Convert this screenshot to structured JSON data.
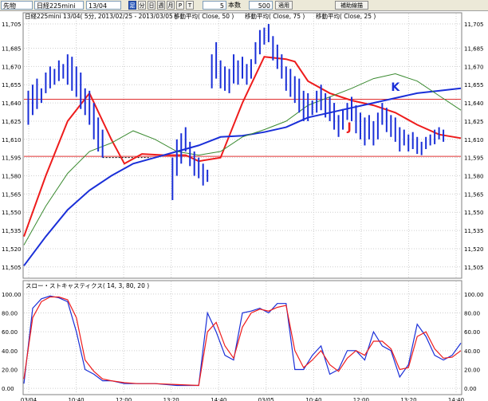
{
  "toolbar": {
    "market": "先物",
    "instrument": "日経225mini",
    "contract": "13/04",
    "buttons": [
      "足",
      "分",
      "日",
      "週",
      "月",
      "P",
      "T"
    ],
    "active_button": "足",
    "interval": "5",
    "interval_unit": "本数",
    "count": "500",
    "apply_label": "適用",
    "trendline_label": "補助線描"
  },
  "colors": {
    "price_bar": "#1a2fd8",
    "ma50": "#1a2fd8",
    "ma75": "#3a8a30",
    "ma25": "#ee1c1c",
    "hline": "#e03030",
    "stoch_k": "#1a2fd8",
    "stoch_d": "#ee1c1c",
    "grid": "#cfcfcf",
    "annotation_k": "#1a2fd8",
    "annotation_j": "#ee1c1c"
  },
  "chart_data": [
    {
      "type": "line",
      "header": {
        "title": "日経225mini 13/04( 5分, 2013/02/25 - 2013/03/05 )",
        "ma_labels": [
          "移動平均( Close, 50 )",
          "移動平均( Close, 75 )",
          "移動平均( Close, 25 )"
        ]
      },
      "ylim": [
        11497,
        11707
      ],
      "yticks": [
        11505,
        11520,
        11535,
        11550,
        11565,
        11580,
        11595,
        11610,
        11625,
        11640,
        11655,
        11670,
        11685,
        11705
      ],
      "y_tick_labels": [
        "11,505",
        "11,520",
        "11,535",
        "11,550",
        "11,565",
        "11,580",
        "11,595",
        "11,610",
        "11,625",
        "11,640",
        "11,655",
        "11,670",
        "11,685",
        "11,705"
      ],
      "xlim": [
        0,
        100
      ],
      "grid": true,
      "series": [
        {
          "name": "移動平均( Close, 25 )",
          "x": [
            0,
            5,
            10,
            15,
            20,
            23,
            27,
            32,
            37,
            40,
            45,
            50,
            55,
            60,
            62,
            65,
            70,
            75,
            80,
            85,
            90,
            95,
            100
          ],
          "values": [
            11530,
            11580,
            11625,
            11648,
            11610,
            11590,
            11598,
            11597,
            11597,
            11592,
            11595,
            11640,
            11678,
            11676,
            11674,
            11658,
            11648,
            11642,
            11638,
            11632,
            11622,
            11614,
            11611
          ]
        },
        {
          "name": "移動平均( Close, 50 )",
          "x": [
            0,
            5,
            10,
            15,
            20,
            25,
            30,
            35,
            40,
            45,
            50,
            55,
            60,
            65,
            70,
            75,
            80,
            85,
            90,
            95,
            100
          ],
          "values": [
            11506,
            11530,
            11552,
            11568,
            11580,
            11590,
            11595,
            11600,
            11605,
            11612,
            11613,
            11616,
            11620,
            11628,
            11632,
            11636,
            11640,
            11644,
            11648,
            11650,
            11652
          ]
        },
        {
          "name": "移動平均( Close, 75 )",
          "x": [
            0,
            5,
            10,
            15,
            20,
            25,
            30,
            35,
            40,
            45,
            50,
            55,
            60,
            65,
            70,
            75,
            80,
            85,
            90,
            95,
            100
          ],
          "values": [
            11523,
            11555,
            11582,
            11600,
            11607,
            11617,
            11610,
            11600,
            11597,
            11600,
            11612,
            11618,
            11625,
            11638,
            11645,
            11652,
            11660,
            11664,
            11658,
            11646,
            11634
          ]
        }
      ],
      "price_bars": {
        "x": [
          1,
          2,
          3,
          4,
          5,
          6,
          7,
          8,
          9,
          10,
          11,
          12,
          13,
          14,
          15,
          16,
          17,
          18,
          34,
          35,
          36,
          37,
          38,
          39,
          40,
          41,
          42,
          43,
          44,
          45,
          46,
          47,
          48,
          49,
          50,
          51,
          52,
          53,
          54,
          55,
          56,
          57,
          58,
          59,
          60,
          61,
          62,
          63,
          64,
          65,
          66,
          67,
          68,
          69,
          70,
          71,
          72,
          73,
          74,
          75,
          76,
          77,
          78,
          79,
          80,
          81,
          82,
          83,
          84,
          85,
          86,
          87,
          88,
          89,
          90,
          91,
          92,
          93,
          94,
          95,
          96
        ],
        "high": [
          11650,
          11655,
          11660,
          11652,
          11665,
          11670,
          11668,
          11675,
          11672,
          11680,
          11678,
          11670,
          11665,
          11652,
          11650,
          11640,
          11628,
          11618,
          11595,
          11610,
          11615,
          11620,
          11608,
          11600,
          11595,
          11590,
          11585,
          11680,
          11690,
          11675,
          11670,
          11668,
          11680,
          11675,
          11678,
          11672,
          11676,
          11690,
          11700,
          11702,
          11705,
          11695,
          11688,
          11680,
          11670,
          11668,
          11662,
          11660,
          11650,
          11648,
          11642,
          11650,
          11655,
          11648,
          11645,
          11640,
          11630,
          11635,
          11640,
          11645,
          11638,
          11632,
          11628,
          11630,
          11625,
          11632,
          11640,
          11636,
          11630,
          11628,
          11620,
          11618,
          11614,
          11616,
          11612,
          11608,
          11612,
          11614,
          11618,
          11620,
          11618
        ],
        "low": [
          11622,
          11630,
          11635,
          11640,
          11648,
          11652,
          11655,
          11658,
          11660,
          11655,
          11650,
          11645,
          11635,
          11630,
          11622,
          11610,
          11600,
          11595,
          11560,
          11580,
          11590,
          11600,
          11588,
          11580,
          11578,
          11572,
          11575,
          11652,
          11660,
          11652,
          11650,
          11648,
          11656,
          11655,
          11660,
          11655,
          11660,
          11672,
          11680,
          11688,
          11690,
          11675,
          11668,
          11660,
          11650,
          11645,
          11640,
          11632,
          11625,
          11625,
          11630,
          11632,
          11634,
          11628,
          11625,
          11618,
          11612,
          11618,
          11626,
          11625,
          11615,
          11610,
          11605,
          11610,
          11605,
          11610,
          11622,
          11616,
          11612,
          11608,
          11600,
          11605,
          11600,
          11602,
          11598,
          11597,
          11602,
          11605,
          11606,
          11610,
          11608
        ]
      },
      "hlines": [
        11643,
        11596
      ],
      "dashed_segment": {
        "x": [
          18,
          29
        ],
        "y": 11595
      },
      "annotations": [
        {
          "text": "K",
          "x": 84,
          "y": 11650
        },
        {
          "text": "J",
          "x": 74,
          "y": 11617
        }
      ]
    },
    {
      "type": "line",
      "title": "スロー・ストキャスティクス( 14, 3, 80, 20 )",
      "ylim": [
        -5,
        105
      ],
      "yticks": [
        0,
        20,
        40,
        60,
        80,
        100
      ],
      "y_tick_labels": [
        "0.00",
        "20.00",
        "40.00",
        "60.00",
        "80.00",
        "100.00"
      ],
      "x_tick_labels": [
        "03/04",
        "10:40",
        "12:00",
        "13:20",
        "14:40",
        "03/05",
        "10:40",
        "12:00",
        "13:20",
        "14:40"
      ],
      "xlim": [
        0,
        100
      ],
      "grid": true,
      "series": [
        {
          "name": "%K",
          "x": [
            0,
            2,
            4,
            6,
            8,
            10,
            12,
            14,
            16,
            18,
            20,
            23,
            26,
            30,
            35,
            40,
            42,
            44,
            46,
            48,
            50,
            52,
            54,
            56,
            58,
            60,
            62,
            64,
            66,
            68,
            70,
            72,
            74,
            76,
            78,
            80,
            82,
            84,
            86,
            88,
            90,
            92,
            94,
            96,
            98,
            100
          ],
          "values": [
            5,
            85,
            95,
            98,
            96,
            92,
            60,
            20,
            15,
            8,
            8,
            5,
            5,
            5,
            3,
            3,
            80,
            60,
            35,
            30,
            80,
            82,
            85,
            80,
            90,
            90,
            20,
            20,
            35,
            45,
            15,
            20,
            40,
            40,
            30,
            60,
            45,
            40,
            12,
            25,
            68,
            55,
            35,
            30,
            35,
            48
          ]
        },
        {
          "name": "%D",
          "x": [
            0,
            2,
            4,
            6,
            8,
            10,
            12,
            14,
            16,
            18,
            20,
            23,
            26,
            30,
            35,
            40,
            42,
            44,
            46,
            48,
            50,
            52,
            54,
            56,
            58,
            60,
            62,
            64,
            66,
            68,
            70,
            72,
            74,
            76,
            78,
            80,
            82,
            84,
            86,
            88,
            90,
            92,
            94,
            96,
            98,
            100
          ],
          "values": [
            10,
            75,
            92,
            97,
            97,
            94,
            75,
            30,
            18,
            10,
            8,
            6,
            5,
            5,
            4,
            3,
            60,
            70,
            45,
            32,
            65,
            80,
            84,
            82,
            86,
            88,
            40,
            22,
            30,
            40,
            25,
            18,
            32,
            40,
            35,
            50,
            50,
            42,
            20,
            22,
            55,
            60,
            42,
            32,
            33,
            40
          ]
        }
      ]
    }
  ]
}
